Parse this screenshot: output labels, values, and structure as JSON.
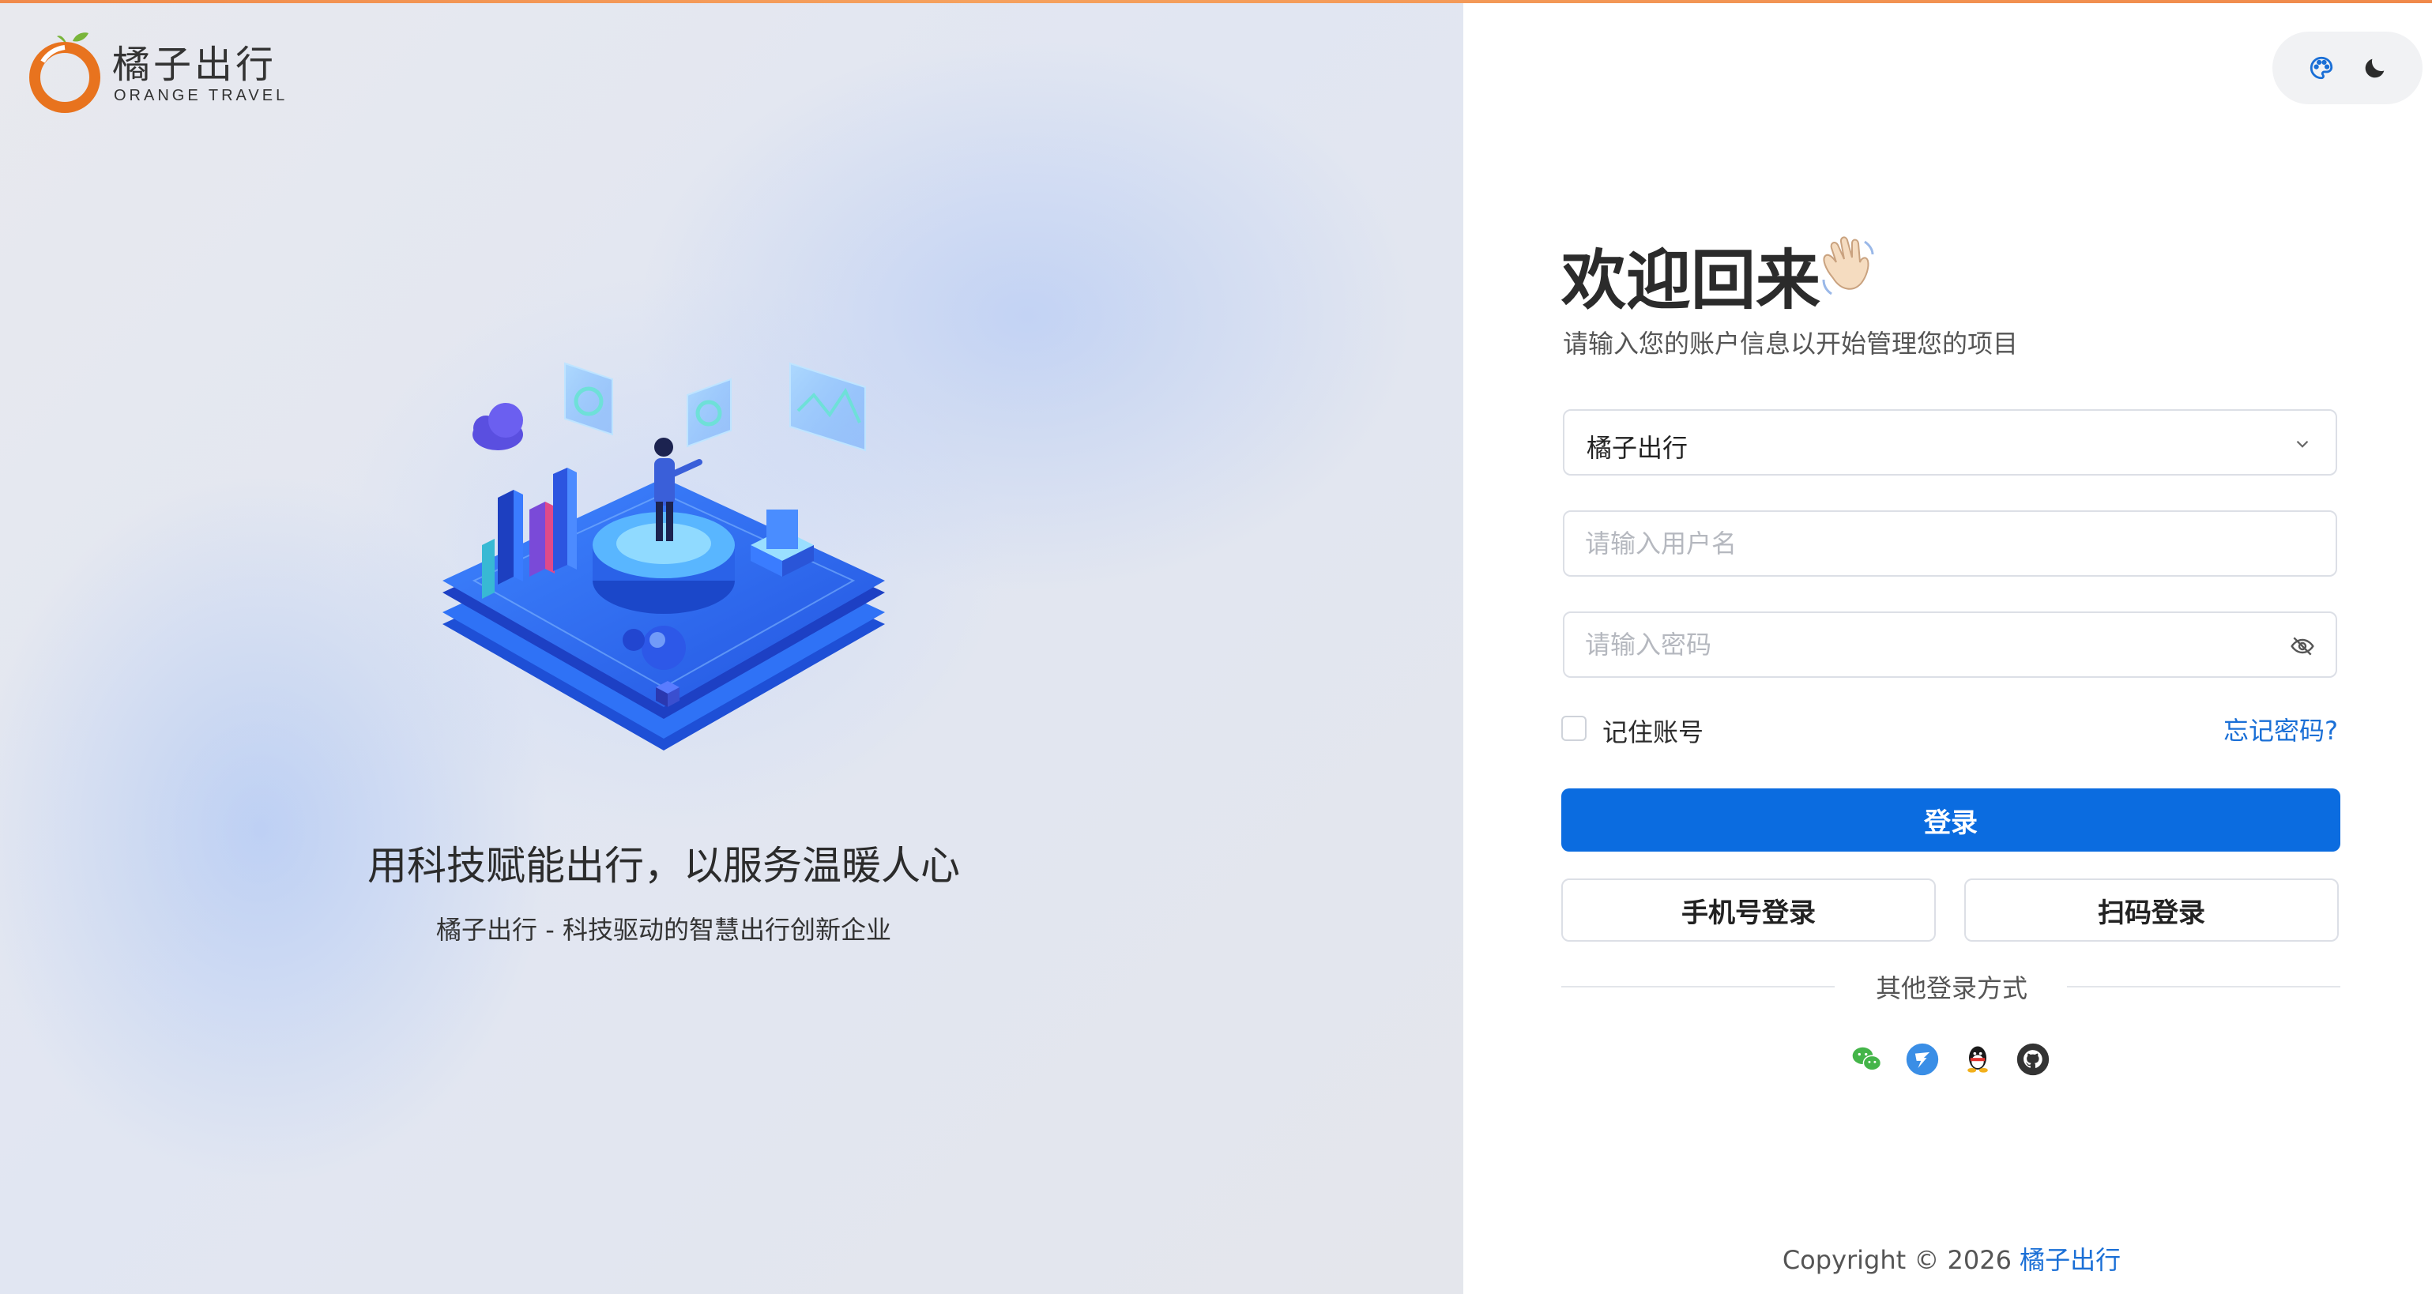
{
  "brand": {
    "name_cn": "橘子出行",
    "name_en": "ORANGE TRAVEL",
    "accent_orange": "#e8731e",
    "leaf_green": "#79b53a"
  },
  "left_panel": {
    "slogan": "用科技赋能出行，以服务温暖人心",
    "sub_slogan": "橘子出行 - 科技驱动的智慧出行创新企业"
  },
  "header": {
    "theme_icon": "palette-icon",
    "dark_mode_icon": "moon-icon"
  },
  "login": {
    "title": "欢迎回来",
    "title_emoji": "waving-hand-icon",
    "subtitle": "请输入您的账户信息以开始管理您的项目",
    "tenant_select": {
      "value": "橘子出行",
      "icon": "chevron-down-icon"
    },
    "username": {
      "placeholder": "请输入用户名",
      "value": ""
    },
    "password": {
      "placeholder": "请输入密码",
      "value": "",
      "icon": "eye-off-icon"
    },
    "remember_label": "记住账号",
    "remember_checked": false,
    "forgot_label": "忘记密码?",
    "submit_label": "登录",
    "phone_login_label": "手机号登录",
    "qr_login_label": "扫码登录",
    "other_methods_label": "其他登录方式",
    "social": [
      "wechat-icon",
      "dingtalk-icon",
      "qq-icon",
      "github-icon"
    ],
    "primary_color": "#0b6ce0",
    "link_color": "#1a6fd6"
  },
  "footer": {
    "copyright_prefix": "Copyright © 2026",
    "copyright_brand": "橘子出行"
  }
}
